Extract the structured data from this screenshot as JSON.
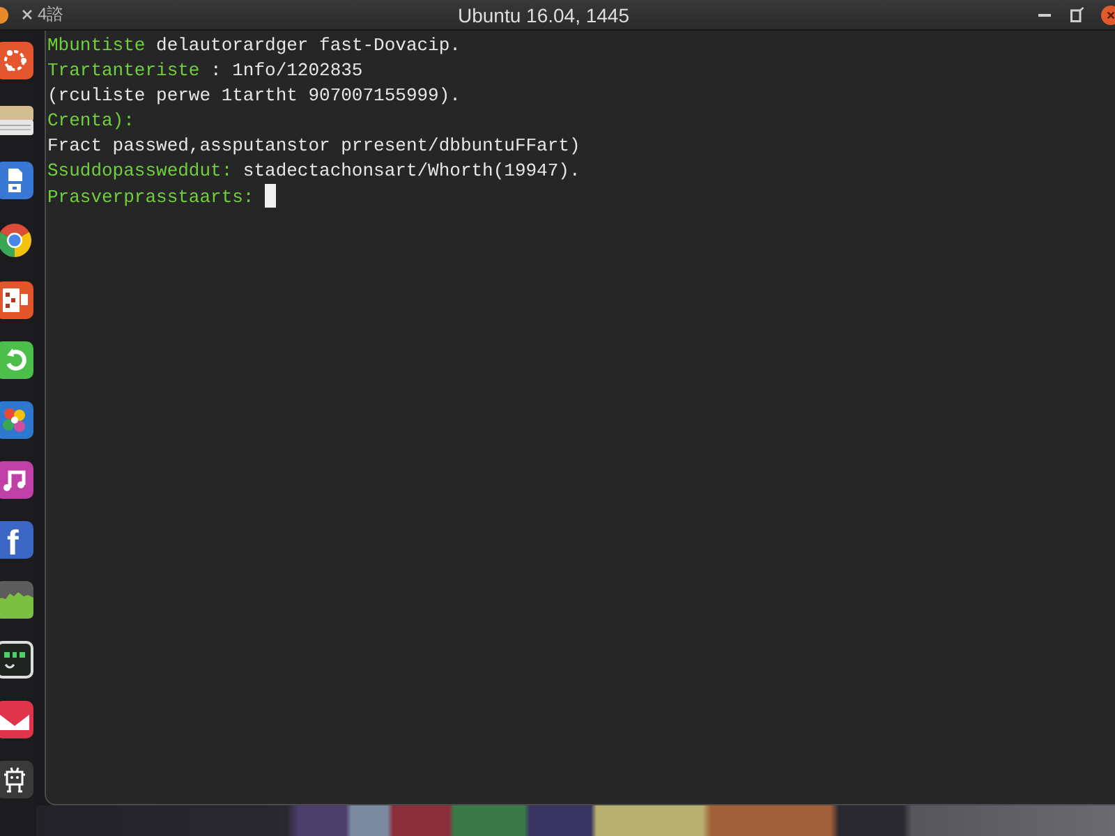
{
  "top_bar": {
    "left_text": "4諮",
    "title": "Ubuntu 16.04, 1445"
  },
  "launcher": {
    "letter_tile": "f"
  },
  "terminal": {
    "cursor": true,
    "lines": [
      {
        "segments": [
          {
            "kind": "label",
            "text": "Mbuntiste"
          },
          {
            "kind": "plain",
            "text": "delautorardger fast-Dovacip."
          }
        ]
      },
      {
        "segments": [
          {
            "kind": "label",
            "text": "Trartanteriste"
          },
          {
            "kind": "plain",
            "text": ": 1nfo/1202835"
          }
        ]
      },
      {
        "segments": [
          {
            "kind": "plain",
            "text": "(rculiste perwe 1tartht 907007155999)."
          }
        ]
      },
      {
        "segments": [
          {
            "kind": "label",
            "text": "Crenta):"
          }
        ]
      },
      {
        "segments": [
          {
            "kind": "plain",
            "text": "Fract passwed,assputanstor prresent/dbbuntuFFart)"
          }
        ]
      },
      {
        "segments": [
          {
            "kind": "label",
            "text": "Ssuddopassweddut:"
          },
          {
            "kind": "plain",
            "text": "stadectachonsart/Whorth(19947)."
          }
        ]
      },
      {
        "segments": [
          {
            "kind": "label",
            "text": "Prasverprasstaarts:"
          }
        ]
      }
    ]
  }
}
